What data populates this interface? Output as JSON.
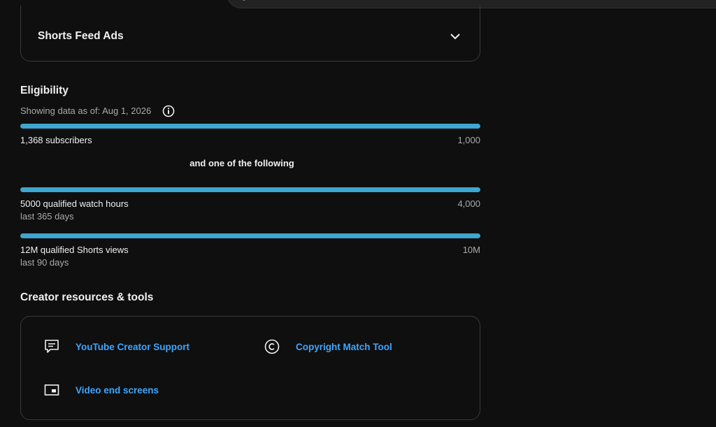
{
  "ads": {
    "title": "Shorts Feed Ads"
  },
  "eligibility": {
    "title": "Eligibility",
    "data_as_of": "Showing data as of: Aug 1, 2026",
    "requirements": [
      {
        "label": "1,368 subscribers",
        "sub": "",
        "target": "1,000",
        "progress": 1.0
      },
      {
        "label": "5000 qualified watch hours",
        "sub": "last 365 days",
        "target": "4,000",
        "progress": 1.0
      },
      {
        "label": "12M qualified Shorts views",
        "sub": "last 90 days",
        "target": "10M",
        "progress": 1.0
      }
    ],
    "one_of_text": "and one of the following"
  },
  "resources": {
    "title": "Creator resources & tools",
    "tools": [
      {
        "label": "YouTube Creator Support",
        "icon": "feedback-icon"
      },
      {
        "label": "Copyright Match Tool",
        "icon": "copyright-icon"
      },
      {
        "label": "Video end screens",
        "icon": "end-screen-icon"
      }
    ]
  },
  "colors": {
    "progress": "#3ea6d0",
    "link": "#3ea6ff",
    "background": "#0f0f0f"
  }
}
